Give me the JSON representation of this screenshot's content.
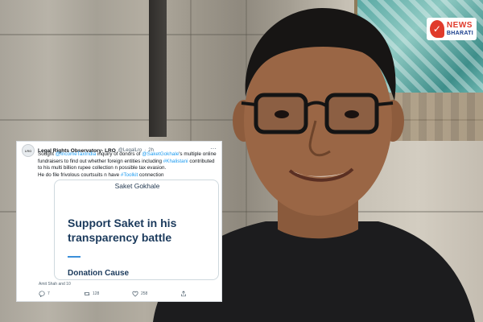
{
  "tweet": {
    "name": "Legal Rights Observatory- LRO",
    "handle": "@LegalLro",
    "time": "2h",
    "text": {
      "p1": "Sought ",
      "link1": "@IncomeTaxIndia",
      "p2": " inquiry of donors of ",
      "link2": "@SaketGokhale",
      "p3": "'s multiple online fundraisers to find out whether foreign entities including ",
      "link3": "#Khalistani",
      "p4": " contributed to his multi billion rupee collection n possible tax evasion.",
      "p5": "He do file frivolous courtsuits n have ",
      "link4": "#Toolkit",
      "p6": " connection"
    },
    "card": {
      "header": "Saket Gokhale",
      "headline": "Support Saket in his transparency battle",
      "cause": "Donation Cause"
    },
    "liked_by": "Amit Shah and 10",
    "actions": {
      "replies": "7",
      "retweets": "128",
      "likes": "258"
    }
  },
  "logo": {
    "top": "NEWS",
    "bottom": "BHARATI"
  },
  "colors": {
    "link": "#1d9bf0",
    "card_heading": "#1b3a5c",
    "logo_red": "#e03a2b",
    "logo_blue": "#1a3e8c"
  }
}
